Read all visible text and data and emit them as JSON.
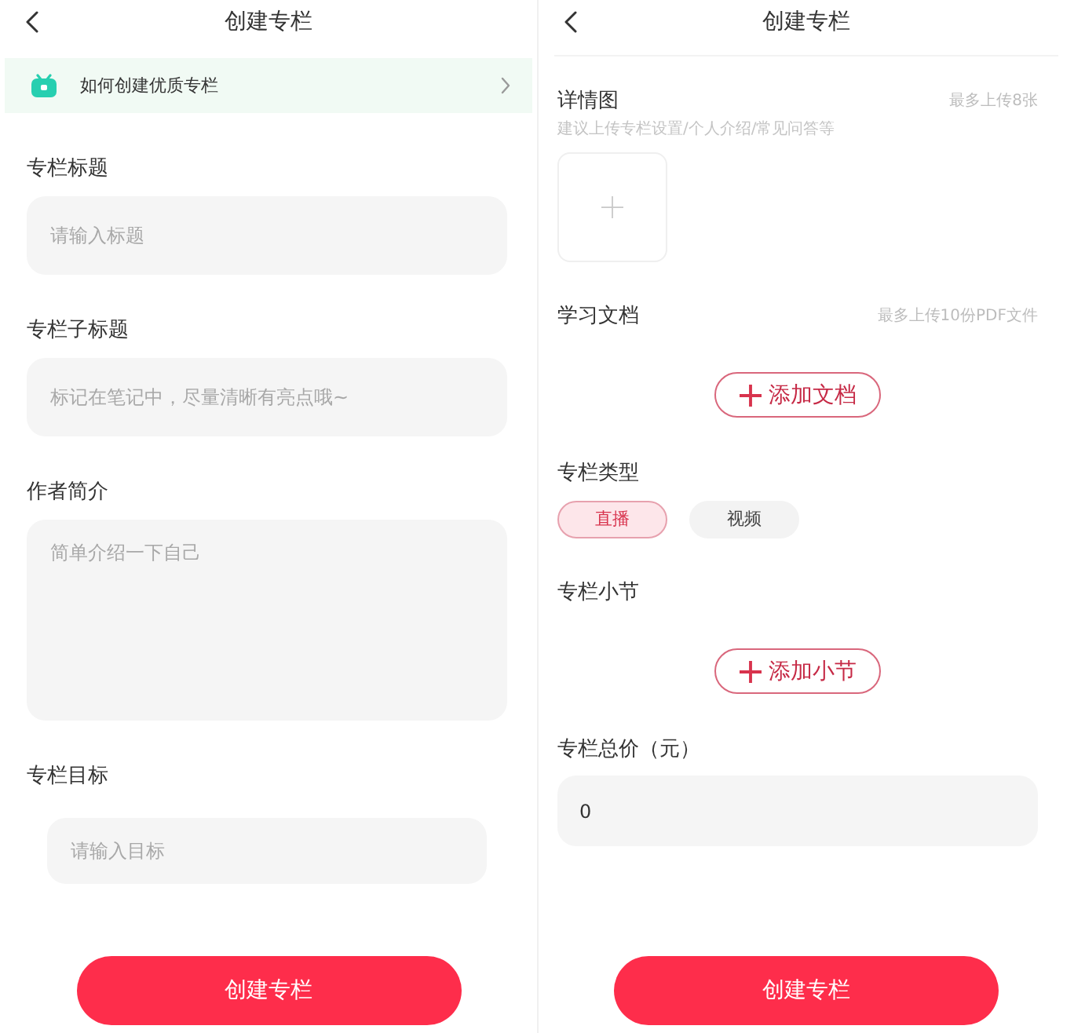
{
  "screens": [
    {
      "header": {
        "title": "创建专栏"
      },
      "banner": {
        "text": "如何创建优质专栏"
      },
      "sections": [
        {
          "kind": "input",
          "label": "专栏标题",
          "placeholder": "请输入标题"
        },
        {
          "kind": "input",
          "label": "专栏子标题",
          "placeholder": "标记在笔记中，尽量清晰有亮点哦~"
        },
        {
          "kind": "textarea",
          "label": "作者简介",
          "placeholder": "简单介绍一下自己"
        },
        {
          "kind": "inset_input",
          "label": "专栏目标",
          "placeholder": "请输入目标"
        }
      ],
      "submit": "创建专栏"
    },
    {
      "header": {
        "title": "创建专栏"
      },
      "sections": [
        {
          "kind": "image_upload",
          "label": "详情图",
          "limit": "最多上传8张",
          "hint": "建议上传专栏设置/个人介绍/常见问答等"
        },
        {
          "kind": "add_button",
          "label": "学习文档",
          "limit": "最多上传10份PDF文件",
          "button": "添加文档"
        },
        {
          "kind": "choice",
          "label": "专栏类型",
          "options": [
            {
              "label": "直播",
              "selected": true
            },
            {
              "label": "视频",
              "selected": false
            }
          ]
        },
        {
          "kind": "add_button",
          "label": "专栏小节",
          "button": "添加小节"
        },
        {
          "kind": "value_input",
          "label": "专栏总价（元）",
          "value": "0"
        }
      ],
      "submit": "创建专栏"
    }
  ]
}
